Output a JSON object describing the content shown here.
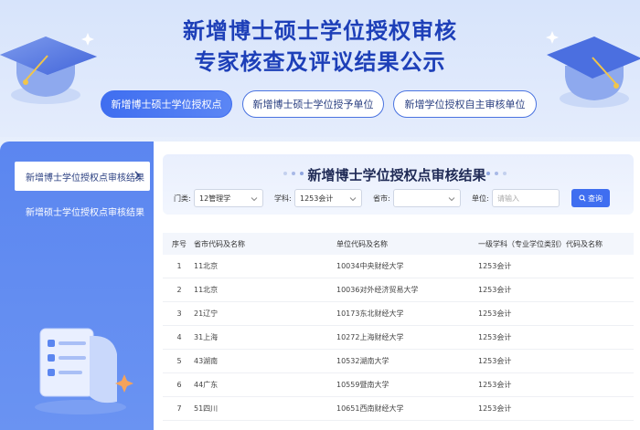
{
  "header": {
    "title_line1": "新增博士硕士学位授权审核",
    "title_line2": "专家核查及评议结果公示"
  },
  "tabs": [
    {
      "label": "新增博士硕士学位授权点",
      "active": true
    },
    {
      "label": "新增博士硕士学位授予单位",
      "active": false
    },
    {
      "label": "新增学位授权自主审核单位",
      "active": false
    }
  ],
  "sidebar": {
    "items": [
      {
        "label": "新增博士学位授权点审核结果",
        "active": true
      },
      {
        "label": "新增硕士学位授权点审核结果",
        "active": false
      }
    ]
  },
  "panel": {
    "title": "新增博士学位授权点审核结果"
  },
  "filters": {
    "category_label": "门类:",
    "category_value": "12管理学",
    "discipline_label": "学科:",
    "discipline_value": "1253会计",
    "province_label": "省市:",
    "province_value": "",
    "unit_label": "单位:",
    "unit_placeholder": "请输入",
    "query_label": "查询"
  },
  "table": {
    "headers": [
      "序号",
      "省市代码及名称",
      "单位代码及名称",
      "一级学科（专业学位类别）代码及名称"
    ],
    "rows": [
      {
        "no": "1",
        "province": "11北京",
        "unit": "10034中央财经大学",
        "discipline": "1253会计"
      },
      {
        "no": "2",
        "province": "11北京",
        "unit": "10036对外经济贸易大学",
        "discipline": "1253会计"
      },
      {
        "no": "3",
        "province": "21辽宁",
        "unit": "10173东北财经大学",
        "discipline": "1253会计"
      },
      {
        "no": "4",
        "province": "31上海",
        "unit": "10272上海财经大学",
        "discipline": "1253会计"
      },
      {
        "no": "5",
        "province": "43湖南",
        "unit": "10532湖南大学",
        "discipline": "1253会计"
      },
      {
        "no": "6",
        "province": "44广东",
        "unit": "10559暨南大学",
        "discipline": "1253会计"
      },
      {
        "no": "7",
        "province": "51四川",
        "unit": "10651西南财经大学",
        "discipline": "1253会计"
      }
    ]
  },
  "colors": {
    "accent": "#3f6ef0",
    "title": "#1d3fb8",
    "sidebar": "#5b86f0"
  }
}
